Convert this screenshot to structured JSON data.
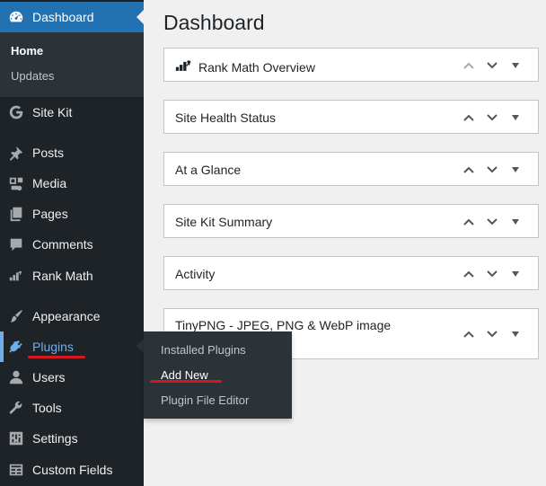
{
  "sidebar": {
    "dashboard": {
      "label": "Dashboard",
      "icon": "dashboard-icon"
    },
    "submenu": {
      "home": "Home",
      "updates": "Updates"
    },
    "items": [
      {
        "key": "site-kit",
        "label": "Site Kit",
        "icon": "google-g-icon"
      },
      {
        "key": "posts",
        "label": "Posts",
        "icon": "pushpin-icon"
      },
      {
        "key": "media",
        "label": "Media",
        "icon": "media-icon"
      },
      {
        "key": "pages",
        "label": "Pages",
        "icon": "pages-icon"
      },
      {
        "key": "comments",
        "label": "Comments",
        "icon": "comment-icon"
      },
      {
        "key": "rank-math",
        "label": "Rank Math",
        "icon": "rank-math-icon"
      },
      {
        "key": "appearance",
        "label": "Appearance",
        "icon": "paintbrush-icon"
      },
      {
        "key": "plugins",
        "label": "Plugins",
        "icon": "plugin-icon"
      },
      {
        "key": "users",
        "label": "Users",
        "icon": "user-icon"
      },
      {
        "key": "tools",
        "label": "Tools",
        "icon": "wrench-icon"
      },
      {
        "key": "settings",
        "label": "Settings",
        "icon": "settings-sliders-icon"
      },
      {
        "key": "custom-fields",
        "label": "Custom Fields",
        "icon": "custom-fields-icon"
      }
    ],
    "plugins_flyout": [
      "Installed Plugins",
      "Add New",
      "Plugin File Editor"
    ]
  },
  "main": {
    "title": "Dashboard",
    "widgets": [
      {
        "title": "Rank Math Overview",
        "has_logo": true
      },
      {
        "title": "Site Health Status"
      },
      {
        "title": "At a Glance"
      },
      {
        "title": "Site Kit Summary"
      },
      {
        "title": "Activity"
      },
      {
        "title": "TinyPNG - JPEG, PNG & WebP image"
      }
    ]
  },
  "colors": {
    "sidebar_bg": "#1d2327",
    "accent": "#2271b1",
    "plugins_highlight": "#72aee6",
    "annotation_red": "#d2191e"
  }
}
